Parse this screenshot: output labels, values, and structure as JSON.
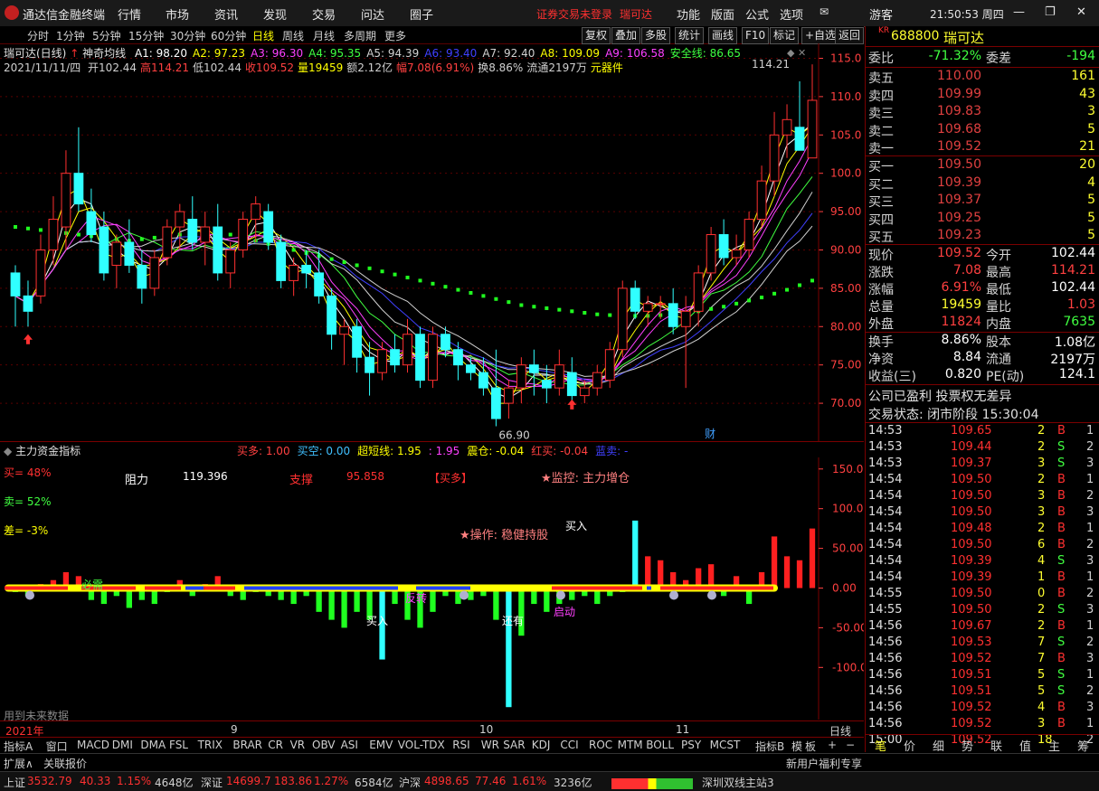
{
  "menubar": {
    "app_title": "通达信金融终端",
    "items": [
      "行情",
      "市场",
      "资讯",
      "发现",
      "交易",
      "问达",
      "圈子"
    ],
    "login_notice": "证券交易未登录",
    "stock_name": "瑞可达",
    "right_items": [
      "功能",
      "版面",
      "公式",
      "选项"
    ],
    "user": "游客",
    "clock": "21:50:53 周四"
  },
  "period_tabs": [
    "分时",
    "1分钟",
    "5分钟",
    "15分钟",
    "30分钟",
    "60分钟",
    "日线",
    "周线",
    "月线",
    "多周期",
    "更多"
  ],
  "right_buttons": [
    "复权",
    "叠加",
    "多股",
    "统计",
    "画线",
    "F10",
    "标记",
    "+自选",
    "返回"
  ],
  "chart_header": {
    "name": "瑞可达(日线)",
    "indicator": "神奇均线",
    "ma_items": [
      {
        "text": "A1: 98.20",
        "color": "#ffffff"
      },
      {
        "text": "A2: 97.23",
        "color": "#ffff00"
      },
      {
        "text": "A3: 96.30",
        "color": "#ff40ff"
      },
      {
        "text": "A4: 95.35",
        "color": "#40ff40"
      },
      {
        "text": "A5: 94.39",
        "color": "#d0d0d0"
      },
      {
        "text": "A6: 93.40",
        "color": "#4040ff"
      },
      {
        "text": "A7: 92.40",
        "color": "#d0d0d0"
      },
      {
        "text": "A8: 109.09",
        "color": "#ffff00"
      },
      {
        "text": "A9: 106.58",
        "color": "#ff40ff"
      },
      {
        "text": "安全线: 86.65",
        "color": "#40ff40"
      }
    ],
    "info_date": "2021/11/11/四",
    "info_items": [
      {
        "text": "开102.44",
        "color": "#d0d0d0"
      },
      {
        "text": "高114.21",
        "color": "#ff4040"
      },
      {
        "text": "低102.44",
        "color": "#d0d0d0"
      },
      {
        "text": "收109.52",
        "color": "#ff4040"
      },
      {
        "text": "量19459",
        "color": "#ffff00"
      },
      {
        "text": "额2.12亿",
        "color": "#d0d0d0"
      },
      {
        "text": "幅7.08(6.91%)",
        "color": "#ff4040"
      },
      {
        "text": "换8.86%",
        "color": "#d0d0d0"
      },
      {
        "text": "流通2197万",
        "color": "#d0d0d0"
      },
      {
        "text": "元器件",
        "color": "#ffff00"
      }
    ]
  },
  "main_axis": {
    "ticks": [
      "115.0",
      "110.0",
      "105.0",
      "100.0",
      "95.00",
      "90.00",
      "85.00",
      "80.00",
      "75.00",
      "70.00"
    ],
    "high_label": "114.21",
    "low_label": "66.90",
    "event_label": "财"
  },
  "sub_panel": {
    "title": "主力资金指标",
    "legend": [
      {
        "text": "买多: 1.00",
        "color": "#ff4040"
      },
      {
        "text": "买空: 0.00",
        "color": "#40c0ff"
      },
      {
        "text": "超短线: 1.95",
        "color": "#ffff00"
      },
      {
        "text": ": 1.95",
        "color": "#ff40ff"
      },
      {
        "text": "震仓: -0.04",
        "color": "#ffff00"
      },
      {
        "text": "红买: -0.04",
        "color": "#ff4040"
      },
      {
        "text": "蓝卖: -",
        "color": "#4040ff"
      }
    ],
    "buy_pct": "买= 48%",
    "sell_pct": "卖= 52%",
    "diff_pct": "差= -3%",
    "resistance_label": "阻力",
    "resistance_value": "119.396",
    "support_label": "支撑",
    "support_value": "95.858",
    "bull_tag": "【买多】",
    "monitor": "★监控: 主力增仓",
    "operation": "★操作: 稳健持股",
    "future_note": "用到未来数据",
    "axis_ticks": [
      "150.0",
      "100.0",
      "50.00",
      "0.00",
      "-50.00",
      "-100.0"
    ],
    "annotations": [
      "必需",
      "买入",
      "还有",
      "启动",
      "买入",
      "反转",
      "卖出",
      "底部"
    ]
  },
  "time_axis": {
    "labels": [
      "2021年",
      "9",
      "10",
      "11"
    ],
    "period": "日线"
  },
  "indicator_tabs": [
    "指标A",
    "窗口",
    "MACD",
    "DMI",
    "DMA",
    "FSL",
    "TRIX",
    "BRAR",
    "CR",
    "VR",
    "OBV",
    "ASI",
    "EMV",
    "VOL-TDX",
    "RSI",
    "WR",
    "SAR",
    "KDJ",
    "CCI",
    "ROC",
    "MTM",
    "BOLL",
    "PSY",
    "MCST"
  ],
  "indicator_right": [
    "指标B",
    "模",
    "板"
  ],
  "ext_bar": {
    "left": [
      "扩展∧",
      "关联报价"
    ],
    "right": "新用户福利专享"
  },
  "quote": {
    "code": "688800",
    "name": "瑞可达",
    "commission_ratio": "-71.32%",
    "commission_diff": "-194",
    "asks": [
      {
        "label": "卖五",
        "price": "110.00",
        "vol": "161"
      },
      {
        "label": "卖四",
        "price": "109.99",
        "vol": "43"
      },
      {
        "label": "卖三",
        "price": "109.83",
        "vol": "3"
      },
      {
        "label": "卖二",
        "price": "109.68",
        "vol": "5"
      },
      {
        "label": "卖一",
        "price": "109.52",
        "vol": "21"
      }
    ],
    "bids": [
      {
        "label": "买一",
        "price": "109.50",
        "vol": "20"
      },
      {
        "label": "买二",
        "price": "109.39",
        "vol": "4"
      },
      {
        "label": "买三",
        "price": "109.37",
        "vol": "5"
      },
      {
        "label": "买四",
        "price": "109.25",
        "vol": "5"
      },
      {
        "label": "买五",
        "price": "109.23",
        "vol": "5"
      }
    ],
    "stats": [
      {
        "l1": "现价",
        "v1": "109.52",
        "c1": "#ff4040",
        "l2": "今开",
        "v2": "102.44",
        "c2": "#ffffff"
      },
      {
        "l1": "涨跌",
        "v1": "7.08",
        "c1": "#ff4040",
        "l2": "最高",
        "v2": "114.21",
        "c2": "#ff4040"
      },
      {
        "l1": "涨幅",
        "v1": "6.91%",
        "c1": "#ff4040",
        "l2": "最低",
        "v2": "102.44",
        "c2": "#ffffff"
      },
      {
        "l1": "总量",
        "v1": "19459",
        "c1": "#ffff30",
        "l2": "量比",
        "v2": "1.03",
        "c2": "#ff4040"
      },
      {
        "l1": "外盘",
        "v1": "11824",
        "c1": "#ff4040",
        "l2": "内盘",
        "v2": "7635",
        "c2": "#40ff40"
      }
    ],
    "stats2": [
      {
        "l1": "换手",
        "v1": "8.86%",
        "l2": "股本",
        "v2": "1.08亿"
      },
      {
        "l1": "净资",
        "v1": "8.84",
        "l2": "流通",
        "v2": "2197万"
      },
      {
        "l1": "收益(三)",
        "v1": "0.820",
        "l2": "PE(动)",
        "v2": "124.1"
      }
    ],
    "notice": "公司已盈利 投票权无差异",
    "trade_status": "交易状态: 闭市阶段 15:30:04",
    "ticks": [
      {
        "t": "14:53",
        "p": "109.65",
        "v": "2",
        "d": "B"
      },
      {
        "t": "14:53",
        "p": "109.44",
        "v": "2",
        "d": "S"
      },
      {
        "t": "14:53",
        "p": "109.37",
        "v": "3",
        "d": "S"
      },
      {
        "t": "14:54",
        "p": "109.50",
        "v": "2",
        "d": "B"
      },
      {
        "t": "14:54",
        "p": "109.50",
        "v": "3",
        "d": "B"
      },
      {
        "t": "14:54",
        "p": "109.50",
        "v": "3",
        "d": "B"
      },
      {
        "t": "14:54",
        "p": "109.48",
        "v": "2",
        "d": "B"
      },
      {
        "t": "14:54",
        "p": "109.50",
        "v": "6",
        "d": "B"
      },
      {
        "t": "14:54",
        "p": "109.39",
        "v": "4",
        "d": "S"
      },
      {
        "t": "14:54",
        "p": "109.39",
        "v": "1",
        "d": "B"
      },
      {
        "t": "14:55",
        "p": "109.50",
        "v": "0",
        "d": "B"
      },
      {
        "t": "14:55",
        "p": "109.50",
        "v": "2",
        "d": "S"
      },
      {
        "t": "14:56",
        "p": "109.67",
        "v": "2",
        "d": "B"
      },
      {
        "t": "14:56",
        "p": "109.53",
        "v": "7",
        "d": "S"
      },
      {
        "t": "14:56",
        "p": "109.52",
        "v": "7",
        "d": "B"
      },
      {
        "t": "14:56",
        "p": "109.51",
        "v": "5",
        "d": "S"
      },
      {
        "t": "14:56",
        "p": "109.51",
        "v": "5",
        "d": "S"
      },
      {
        "t": "14:56",
        "p": "109.52",
        "v": "4",
        "d": "B"
      },
      {
        "t": "14:56",
        "p": "109.52",
        "v": "3",
        "d": "B"
      },
      {
        "t": "15:00",
        "p": "109.52",
        "v": "18",
        "d": ""
      }
    ],
    "bottom_tabs": [
      "笔",
      "价",
      "细",
      "势",
      "联",
      "值",
      "主",
      "筹"
    ]
  },
  "statusbar": {
    "sh_label": "上证",
    "sh_val": "3532.79",
    "sh_chg": "40.33",
    "sh_pct": "1.15%",
    "sh_amt": "4648亿",
    "sz_label": "深证",
    "sz_val": "14699.7",
    "sz_chg": "183.86",
    "sz_pct": "1.27%",
    "sz_amt": "6584亿",
    "hs_label": "沪深",
    "hs_val": "4898.65",
    "hs_chg": "77.46",
    "hs_pct": "1.61%",
    "hs_amt": "3236亿",
    "server": "深圳双线主站3"
  },
  "colors": {
    "up": "#ff3030",
    "down": "#30ffff",
    "ma_green": "#20ff20",
    "border": "#7a0000"
  },
  "chart_data": {
    "type": "candlestick",
    "ylim": [
      66,
      116
    ],
    "sub_ylim": [
      -160,
      160
    ],
    "candles": [
      [
        87,
        88,
        80,
        84
      ],
      [
        84,
        86,
        80,
        82
      ],
      [
        84,
        92,
        83,
        90
      ],
      [
        90,
        97,
        88,
        94
      ],
      [
        93,
        103,
        90,
        100
      ],
      [
        100,
        106,
        95,
        96
      ],
      [
        95,
        98,
        91,
        92
      ],
      [
        93,
        95,
        86,
        87
      ],
      [
        88,
        92,
        85,
        91
      ],
      [
        91,
        94,
        87,
        88
      ],
      [
        88,
        90,
        83,
        85
      ],
      [
        85,
        90,
        84,
        89
      ],
      [
        89,
        94,
        88,
        93
      ],
      [
        93,
        96,
        90,
        95
      ],
      [
        94,
        97,
        90,
        91
      ],
      [
        91,
        95,
        88,
        93
      ],
      [
        93,
        96,
        86,
        87
      ],
      [
        87,
        91,
        85,
        90
      ],
      [
        90,
        95,
        89,
        94
      ],
      [
        94,
        97,
        91,
        96
      ],
      [
        95,
        96,
        90,
        91
      ],
      [
        91,
        92,
        85,
        86
      ],
      [
        86,
        89,
        84,
        88
      ],
      [
        88,
        90,
        85,
        87
      ],
      [
        87,
        90,
        83,
        84
      ],
      [
        84,
        85,
        77,
        79
      ],
      [
        79,
        81,
        75,
        80
      ],
      [
        80,
        81,
        74,
        76
      ],
      [
        76,
        78,
        71,
        74
      ],
      [
        74,
        78,
        73,
        77
      ],
      [
        77,
        79,
        74,
        75
      ],
      [
        75,
        81,
        74,
        79
      ],
      [
        79,
        80,
        72,
        73
      ],
      [
        73,
        80,
        72,
        79
      ],
      [
        79,
        80,
        76,
        77
      ],
      [
        77,
        78,
        73,
        75
      ],
      [
        75,
        76,
        73,
        74
      ],
      [
        74,
        76,
        71,
        72
      ],
      [
        72,
        77,
        67,
        68
      ],
      [
        70,
        73,
        68,
        72
      ],
      [
        72,
        76,
        70,
        75
      ],
      [
        75,
        77,
        71,
        74
      ],
      [
        73,
        75,
        70,
        72
      ],
      [
        72,
        77,
        71,
        75
      ],
      [
        74,
        76,
        70,
        71
      ],
      [
        71,
        73,
        70,
        72
      ],
      [
        72,
        75,
        71,
        74
      ],
      [
        73,
        78,
        72,
        77
      ],
      [
        77,
        86,
        76,
        85
      ],
      [
        85,
        86,
        81,
        82
      ],
      [
        82,
        84,
        80,
        83
      ],
      [
        83,
        84,
        81,
        83
      ],
      [
        83,
        85,
        79,
        80
      ],
      [
        80,
        84,
        72,
        82
      ],
      [
        82,
        88,
        80,
        87
      ],
      [
        87,
        93,
        86,
        92
      ],
      [
        92,
        94,
        88,
        89
      ],
      [
        89,
        92,
        88,
        90
      ],
      [
        90,
        95,
        89,
        94
      ],
      [
        94,
        101,
        93,
        99
      ],
      [
        99,
        108,
        97,
        105
      ],
      [
        105,
        109,
        102,
        107
      ],
      [
        106,
        112,
        104,
        103
      ],
      [
        102,
        114.21,
        102.44,
        109.52
      ]
    ],
    "safety_line": [
      93,
      92.8,
      92.6,
      92.4,
      92.2,
      92,
      91.8,
      91.6,
      91.4,
      91.2,
      91.4,
      91.6,
      91.8,
      92,
      92.2,
      92.3,
      92.2,
      92,
      91.6,
      91.2,
      90.8,
      90.4,
      90,
      89.6,
      89.2,
      88.8,
      88.4,
      88,
      87.6,
      87.2,
      86.8,
      86.4,
      86,
      85.6,
      85.2,
      84.8,
      84.4,
      84,
      83.6,
      83.2,
      82.8,
      82.6,
      82.4,
      82.2,
      82,
      81.8,
      81.6,
      81.5,
      81.4,
      81.4,
      81.4,
      81.5,
      81.6,
      81.8,
      82,
      82.3,
      82.6,
      83,
      83.4,
      83.8,
      84.3,
      84.8,
      85.4,
      86,
      86.65
    ],
    "fund_bars": [
      -5,
      -10,
      5,
      10,
      20,
      15,
      -15,
      -20,
      -10,
      -25,
      -15,
      -20,
      -5,
      10,
      -10,
      5,
      15,
      -10,
      -15,
      -5,
      -10,
      -15,
      -20,
      -10,
      -30,
      -40,
      -50,
      -30,
      -40,
      -90,
      -20,
      -40,
      -50,
      -30,
      -10,
      -20,
      -15,
      -10,
      -40,
      -150,
      -60,
      -20,
      -30,
      -20,
      -15,
      -10,
      -20,
      -10,
      -5,
      85,
      40,
      35,
      20,
      10,
      25,
      30,
      -10,
      15,
      -20,
      20,
      65,
      40,
      35,
      75,
      55,
      40,
      -5
    ]
  }
}
